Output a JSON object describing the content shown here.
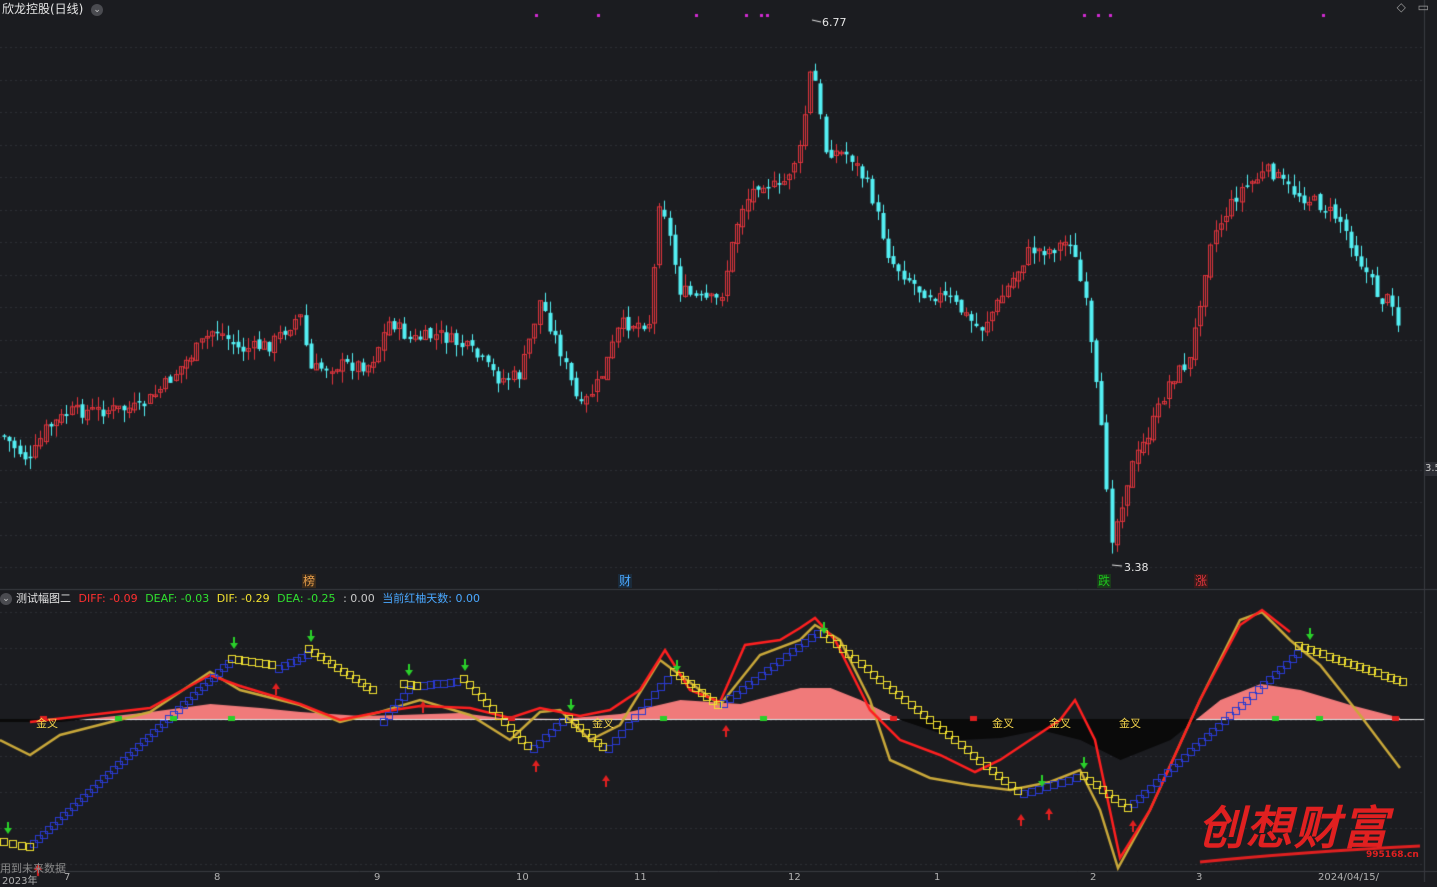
{
  "window": {
    "title": "欣龙控股(日线)",
    "price_axis_label": "3.5"
  },
  "main_chart": {
    "high_label": "6.77",
    "low_label": "3.38",
    "colors": {
      "up": "#e0343c",
      "down": "#54f0f4",
      "grid": "#3a3b40",
      "bg": "#1b1c20"
    },
    "event_markers": [
      {
        "label": "榜",
        "color": "#e59e4b"
      },
      {
        "label": "财",
        "color": "#4aa8ff"
      },
      {
        "label": "跌",
        "color": "#1ec31e"
      },
      {
        "label": "涨",
        "color": "#e0343c"
      }
    ]
  },
  "indicator": {
    "name": "测试幅图二",
    "fields": [
      {
        "label": "DIFF: -0.09",
        "color": "#ff3030"
      },
      {
        "label": "DEAF: -0.03",
        "color": "#30e030"
      },
      {
        "label": "DIF: -0.29",
        "color": "#f0e030"
      },
      {
        "label": "DEA: -0.25",
        "color": "#30e030"
      },
      {
        "label": ": 0.00",
        "color": "#c8c8c8"
      },
      {
        "label": "当前红柚天数: 0.00",
        "color": "#4aa8ff"
      }
    ],
    "signal_labels": [
      "金叉",
      "金叉",
      "金叉",
      "金叉",
      "金叉"
    ]
  },
  "footer": {
    "note": "用到未来数据",
    "date_axis": [
      "2023年",
      "7",
      "8",
      "9",
      "10",
      "11",
      "12",
      "1",
      "2",
      "3",
      "2024/04/15/"
    ]
  },
  "watermark": {
    "text": "创想财富",
    "url": "995168.cn"
  },
  "icons": [
    "settings-icon",
    "window-close-icon"
  ]
}
